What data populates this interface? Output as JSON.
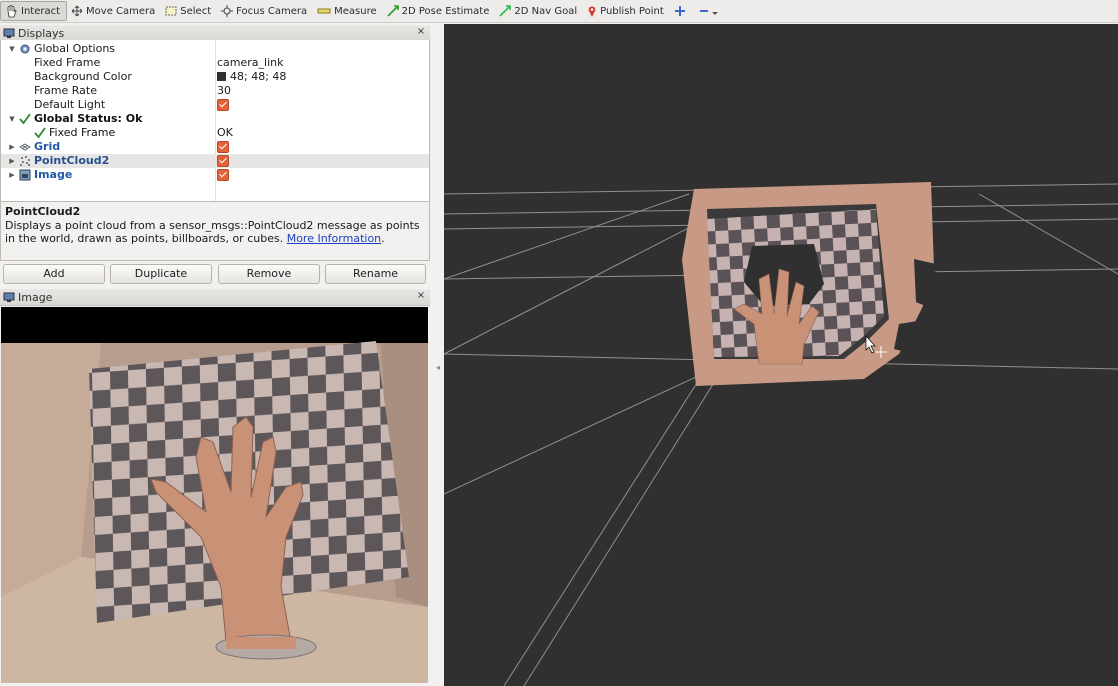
{
  "toolbar": {
    "tools": [
      {
        "label": "Interact",
        "icon": "hand-icon"
      },
      {
        "label": "Move Camera",
        "icon": "move-camera-icon"
      },
      {
        "label": "Select",
        "icon": "select-icon"
      },
      {
        "label": "Focus Camera",
        "icon": "focus-camera-icon"
      },
      {
        "label": "Measure",
        "icon": "measure-icon"
      },
      {
        "label": "2D Pose Estimate",
        "icon": "pose-arrow-icon"
      },
      {
        "label": "2D Nav Goal",
        "icon": "nav-arrow-icon"
      },
      {
        "label": "Publish Point",
        "icon": "map-pin-icon"
      }
    ],
    "active_tool": "Interact"
  },
  "displays_panel": {
    "title": "Displays",
    "close": "×",
    "rows": [
      {
        "label": "Global Options",
        "value": ""
      },
      {
        "label": "Fixed Frame",
        "value": "camera_link"
      },
      {
        "label": "Background Color",
        "value": "48; 48; 48"
      },
      {
        "label": "Frame Rate",
        "value": "30"
      },
      {
        "label": "Default Light",
        "value": ""
      },
      {
        "label": "Global Status: Ok",
        "value": ""
      },
      {
        "label": "Fixed Frame",
        "value": "OK"
      },
      {
        "label": "Grid",
        "value": ""
      },
      {
        "label": "PointCloud2",
        "value": ""
      },
      {
        "label": "Image",
        "value": ""
      }
    ],
    "background_color_hex": "#303030",
    "checked_color": "#e0633a"
  },
  "description": {
    "title": "PointCloud2",
    "text": "Displays a point cloud from a sensor_msgs::PointCloud2 message as points in the world, drawn as points, billboards, or cubes.",
    "link": "More Information",
    "after_link": "."
  },
  "buttons": {
    "add": "Add",
    "duplicate": "Duplicate",
    "remove": "Remove",
    "rename": "Rename"
  },
  "image_panel": {
    "title": "Image",
    "close": "×"
  }
}
